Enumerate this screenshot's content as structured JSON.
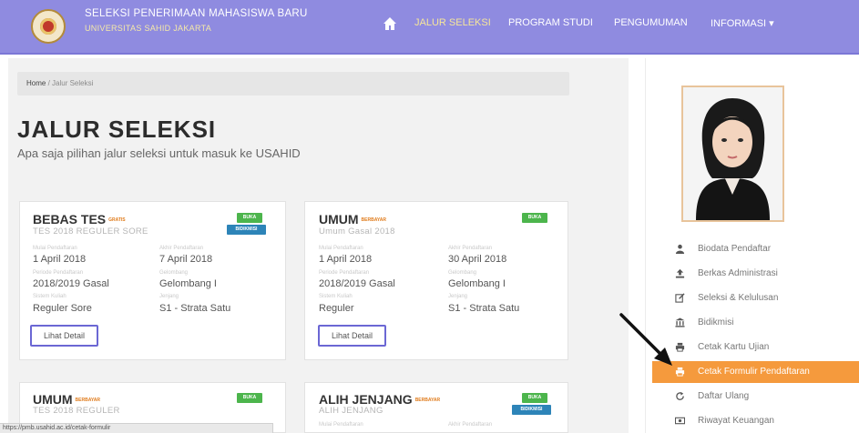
{
  "header": {
    "title": "SELEKSI PENERIMAAN MAHASISWA BARU",
    "subtitle": "UNIVERSITAS SAHID JAKARTA",
    "nav": [
      "JALUR SELEKSI",
      "PROGRAM STUDI",
      "PENGUMUMAN",
      "INFORMASI ▾"
    ],
    "nav_active_color": "#f6e69a",
    "bar_color": "#8f8be0"
  },
  "breadcrumb": {
    "home": "Home",
    "current": "Jalur Seleksi"
  },
  "page": {
    "title": "JALUR SELEKSI",
    "subtitle": "Apa saja pilihan jalur seleksi untuk masuk ke USAHID"
  },
  "cards": [
    {
      "title": "BEBAS TES",
      "tag": "GRATIS",
      "subtitle": "TES 2018 REGULER SORE",
      "badges": [
        "BUKA",
        "BIDIKMISI"
      ],
      "fields": [
        {
          "label": "Mulai Pendaftaran",
          "value": "1 April 2018"
        },
        {
          "label": "Akhir Pendaftaran",
          "value": "7 April 2018"
        },
        {
          "label": "Periode Pendaftaran",
          "value": "2018/2019 Gasal"
        },
        {
          "label": "Gelombang",
          "value": "Gelombang I"
        },
        {
          "label": "Sistem Kuliah",
          "value": "Reguler Sore"
        },
        {
          "label": "Jenjang",
          "value": "S1 - Strata Satu"
        }
      ],
      "button": "Lihat Detail"
    },
    {
      "title": "UMUM",
      "tag": "BERBAYAR",
      "subtitle": "Umum Gasal 2018",
      "badges": [
        "BUKA"
      ],
      "fields": [
        {
          "label": "Mulai Pendaftaran",
          "value": "1 April 2018"
        },
        {
          "label": "Akhir Pendaftaran",
          "value": "30 April 2018"
        },
        {
          "label": "Periode Pendaftaran",
          "value": "2018/2019 Gasal"
        },
        {
          "label": "Gelombang",
          "value": "Gelombang I"
        },
        {
          "label": "Sistem Kuliah",
          "value": "Reguler"
        },
        {
          "label": "Jenjang",
          "value": "S1 - Strata Satu"
        }
      ],
      "button": "Lihat Detail"
    },
    {
      "title": "UMUM",
      "tag": "BERBAYAR",
      "subtitle": "TES 2018 REGULER",
      "badges": [
        "BUKA"
      ]
    },
    {
      "title": "ALIH JENJANG",
      "tag": "BERBAYAR",
      "subtitle": "ALIH JENJANG",
      "badges": [
        "BUKA",
        "BIDIKMISI"
      ],
      "fields": [
        {
          "label": "Mulai Pendaftaran",
          "value": ""
        },
        {
          "label": "Akhir Pendaftaran",
          "value": ""
        }
      ]
    }
  ],
  "sidebar": {
    "items": [
      {
        "label": "Biodata Pendaftar",
        "icon": "user-icon"
      },
      {
        "label": "Berkas Administrasi",
        "icon": "upload-icon"
      },
      {
        "label": "Seleksi & Kelulusan",
        "icon": "edit-icon"
      },
      {
        "label": "Bidikmisi",
        "icon": "bank-icon"
      },
      {
        "label": "Cetak Kartu Ujian",
        "icon": "print-icon"
      },
      {
        "label": "Cetak Formulir Pendaftaran",
        "icon": "print-icon",
        "active": true
      },
      {
        "label": "Daftar Ulang",
        "icon": "refresh-icon"
      },
      {
        "label": "Riwayat Keuangan",
        "icon": "money-icon"
      }
    ],
    "active_color": "#f59a3d"
  },
  "status_url": "https://pmb.usahid.ac.id/cetak-formulir"
}
